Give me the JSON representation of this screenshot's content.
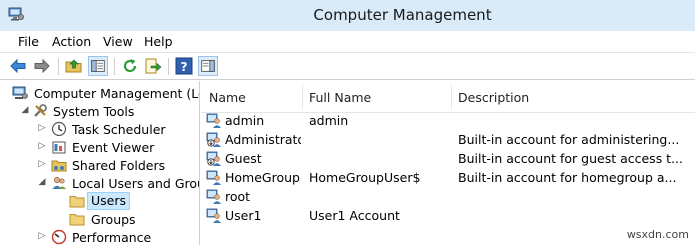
{
  "window": {
    "title": "Computer Management"
  },
  "menu": {
    "file": "File",
    "action": "Action",
    "view": "View",
    "help": "Help"
  },
  "toolbar": {
    "buttons": [
      "back-arrow-icon",
      "forward-arrow-icon",
      "up-folder-icon",
      "show-hide-tree-icon",
      "refresh-icon",
      "export-list-icon",
      "help-icon",
      "show-hide-action-pane-icon"
    ]
  },
  "tree": {
    "root": "Computer Management (Local",
    "system_tools": "System Tools",
    "task_scheduler": "Task Scheduler",
    "event_viewer": "Event Viewer",
    "shared_folders": "Shared Folders",
    "local_users_groups": "Local Users and Groups",
    "users": "Users",
    "groups": "Groups",
    "performance": "Performance"
  },
  "list": {
    "columns": {
      "name": "Name",
      "full_name": "Full Name",
      "description": "Description"
    },
    "rows": [
      {
        "name": "admin",
        "full_name": "admin",
        "description": "",
        "disabled": false
      },
      {
        "name": "Administrator",
        "full_name": "",
        "description": "Built-in account for administering...",
        "disabled": true
      },
      {
        "name": "Guest",
        "full_name": "",
        "description": "Built-in account for guest access t...",
        "disabled": true
      },
      {
        "name": "HomeGroup...",
        "full_name": "HomeGroupUser$",
        "description": "Built-in account for homegroup a...",
        "disabled": false
      },
      {
        "name": "root",
        "full_name": "",
        "description": "",
        "disabled": false
      },
      {
        "name": "User1",
        "full_name": "User1 Account",
        "description": "",
        "disabled": false
      }
    ]
  },
  "watermark": "wsxdn.com",
  "colors": {
    "titlebar": "#d9ebf9",
    "selection": "#cce8ff",
    "accent": "#3d7ab8"
  }
}
